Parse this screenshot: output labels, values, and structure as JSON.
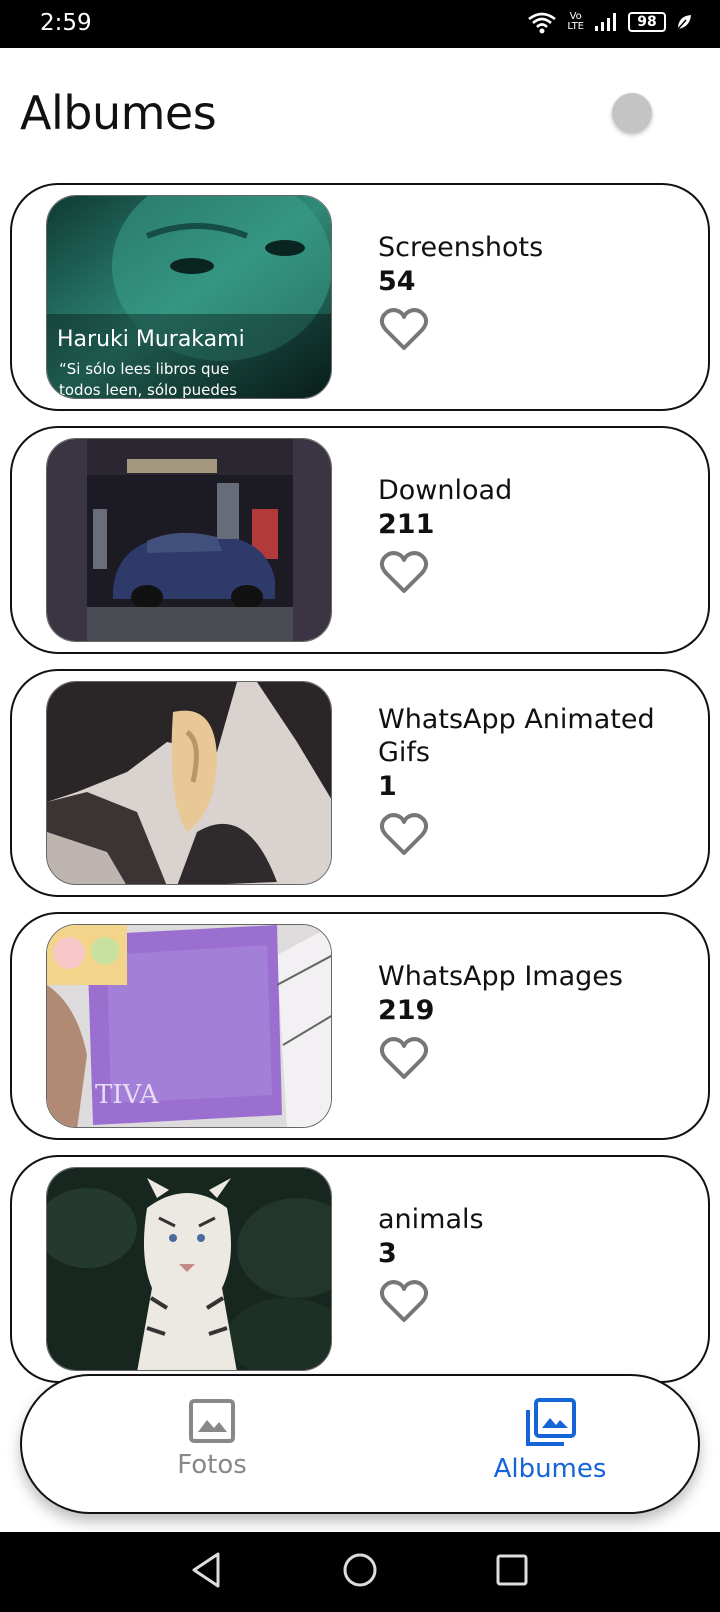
{
  "status_bar": {
    "time": "2:59",
    "volte_top": "Vo",
    "volte_bottom": "LTE",
    "battery": "98"
  },
  "header": {
    "title": "Albumes"
  },
  "albums": [
    {
      "name": "Screenshots",
      "count": "54",
      "thumbnail": "haruki-murakami-quote",
      "thumb_text": {
        "name": "Haruki Murakami",
        "line1": "“Si sólo lees libros que",
        "line2": "todos leen, sólo puedes"
      }
    },
    {
      "name": "Download",
      "count": "211",
      "thumbnail": "blue-car-at-gas-station"
    },
    {
      "name": "WhatsApp Animated Gifs",
      "count": "1",
      "thumbnail": "anime-character-ear"
    },
    {
      "name": "WhatsApp Images",
      "count": "219",
      "thumbnail": "purple-fabric-bag",
      "thumb_text": {
        "brand": "TIVA"
      }
    },
    {
      "name": "animals",
      "count": "3",
      "thumbnail": "white-tiger"
    }
  ],
  "bottom_nav": {
    "items": [
      {
        "label": "Fotos",
        "icon": "image-icon",
        "active": false
      },
      {
        "label": "Albumes",
        "icon": "photo-library-icon",
        "active": true
      }
    ]
  },
  "colors": {
    "active": "#1565d8",
    "inactive": "#888888",
    "heart_outline": "#777777"
  }
}
